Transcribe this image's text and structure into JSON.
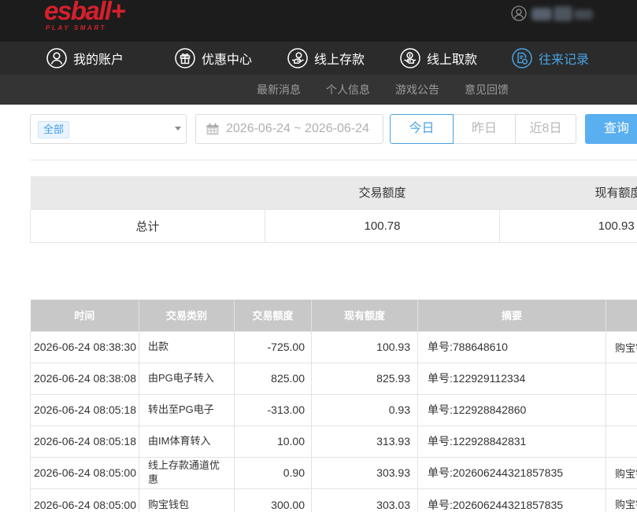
{
  "header": {
    "logo_text": "esball+",
    "logo_tagline": "PLAY SMART",
    "user_icon": "user-circle-icon"
  },
  "nav": {
    "items": [
      {
        "label": "我的账户",
        "icon": "user-icon",
        "active": false
      },
      {
        "label": "优惠中心",
        "icon": "gift-icon",
        "active": false
      },
      {
        "label": "线上存款",
        "icon": "deposit-icon",
        "active": false
      },
      {
        "label": "线上取款",
        "icon": "withdraw-icon",
        "active": false
      },
      {
        "label": "往来记录",
        "icon": "record-icon",
        "active": true
      }
    ]
  },
  "subnav": {
    "items": [
      {
        "label": "最新消息"
      },
      {
        "label": "个人信息"
      },
      {
        "label": "游戏公告"
      },
      {
        "label": "意见回馈"
      }
    ]
  },
  "filters": {
    "category_select": {
      "selected": "全部",
      "icon": "caret-down-icon"
    },
    "date_range": {
      "value": "2026-06-24 ~ 2026-06-24",
      "icon": "calendar-icon"
    },
    "quick_ranges": [
      {
        "label": "今日",
        "active": true
      },
      {
        "label": "昨日",
        "active": false
      },
      {
        "label": "近8日",
        "active": false
      }
    ],
    "query_label": "查询"
  },
  "summary": {
    "header": {
      "amount": "交易额度",
      "balance": "现有额度"
    },
    "row": {
      "label": "总计",
      "amount": "100.78",
      "balance": "100.93"
    }
  },
  "transactions": {
    "columns": {
      "time": "时间",
      "type": "交易类别",
      "amount": "交易额度",
      "balance": "现有额度",
      "memo": "摘要"
    },
    "rows": [
      {
        "time": "2026-06-24 08:38:30",
        "type": "出款",
        "amount": "-725.00",
        "balance": "100.93",
        "memo": "单号:788648610",
        "extra": "购宝钱"
      },
      {
        "time": "2026-06-24 08:38:08",
        "type": "由PG电子转入",
        "amount": "825.00",
        "balance": "825.93",
        "memo": "单号:122929112334"
      },
      {
        "time": "2026-06-24 08:05:18",
        "type": "转出至PG电子",
        "amount": "-313.00",
        "balance": "0.93",
        "memo": "单号:122928842860"
      },
      {
        "time": "2026-06-24 08:05:18",
        "type": "由IM体育转入",
        "amount": "10.00",
        "balance": "313.93",
        "memo": "单号:122928842831"
      },
      {
        "time": "2026-06-24 08:05:00",
        "type": "线上存款通道优惠",
        "amount": "0.90",
        "balance": "303.93",
        "memo": "单号:202606244321857835",
        "extra": "购宝钱"
      },
      {
        "time": "2026-06-24 08:05:00",
        "type": "购宝钱包",
        "amount": "300.00",
        "balance": "303.03",
        "memo": "单号:202606244321857835",
        "extra": "购宝钱"
      }
    ]
  },
  "colors": {
    "header_bg": "#1c1c1c",
    "nav_bg": "#2b2b2b",
    "subnav_bg": "#343434",
    "accent": "#47a3e3",
    "query_button": "#5aaff0",
    "logo_red": "#d6202b",
    "summary_header_bg": "#e9e9e9",
    "table_header_bg": "#c8c8c8"
  }
}
